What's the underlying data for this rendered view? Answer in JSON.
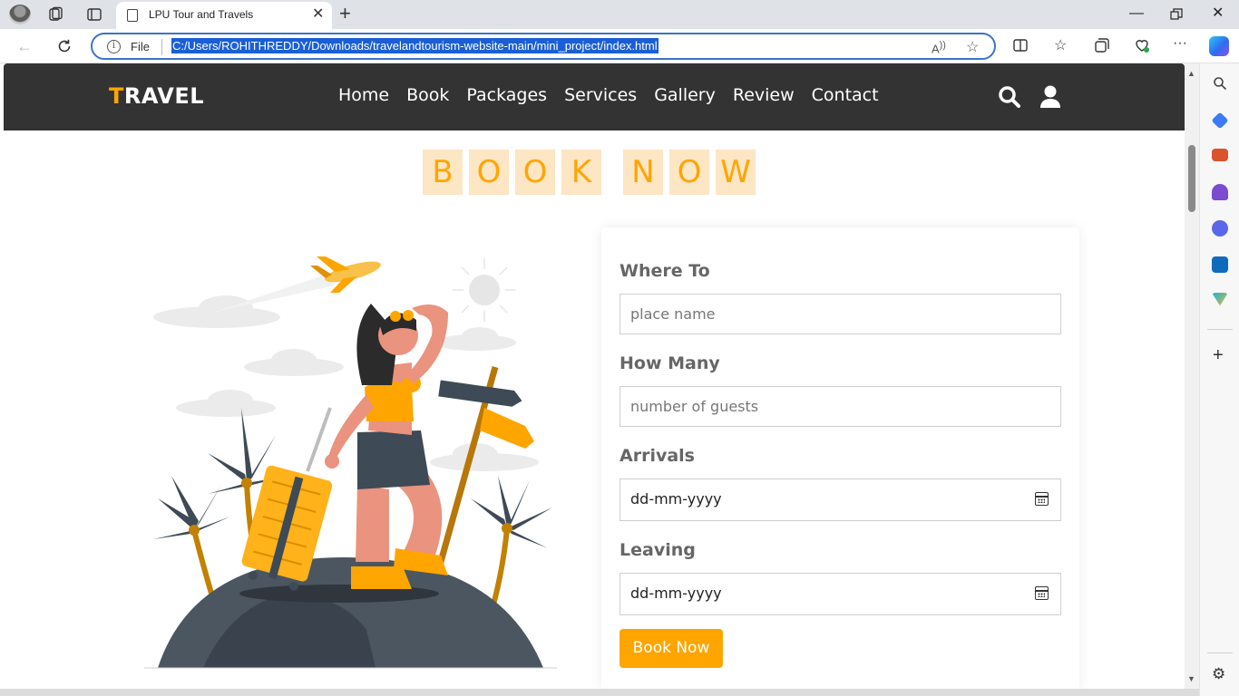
{
  "browser": {
    "tab_title": "LPU Tour and Travels",
    "file_label": "File",
    "url": "C:/Users/ROHITHREDDY/Downloads/travelandtourism-website-main/mini_project/index.html"
  },
  "site": {
    "logo_first": "T",
    "logo_rest": "RAVEL",
    "nav": [
      "Home",
      "Book",
      "Packages",
      "Services",
      "Gallery",
      "Review",
      "Contact"
    ],
    "heading_word1": [
      "B",
      "O",
      "O",
      "K"
    ],
    "heading_word2": [
      "N",
      "O",
      "W"
    ]
  },
  "form": {
    "where_label": "Where To",
    "where_placeholder": "place name",
    "how_many_label": "How Many",
    "how_many_placeholder": "number of guests",
    "arrivals_label": "Arrivals",
    "arrivals_value": "dd-mm-yyyy",
    "leaving_label": "Leaving",
    "leaving_value": "dd-mm-yyyy",
    "submit_label": "Book Now"
  },
  "colors": {
    "accent": "#ffa500",
    "header_bg": "#333333",
    "letter_bg": "#fce6c4"
  },
  "icons": [
    "search-icon",
    "user-icon",
    "calendar-icon",
    "refresh-icon",
    "back-icon",
    "star-icon",
    "settings-icon"
  ]
}
